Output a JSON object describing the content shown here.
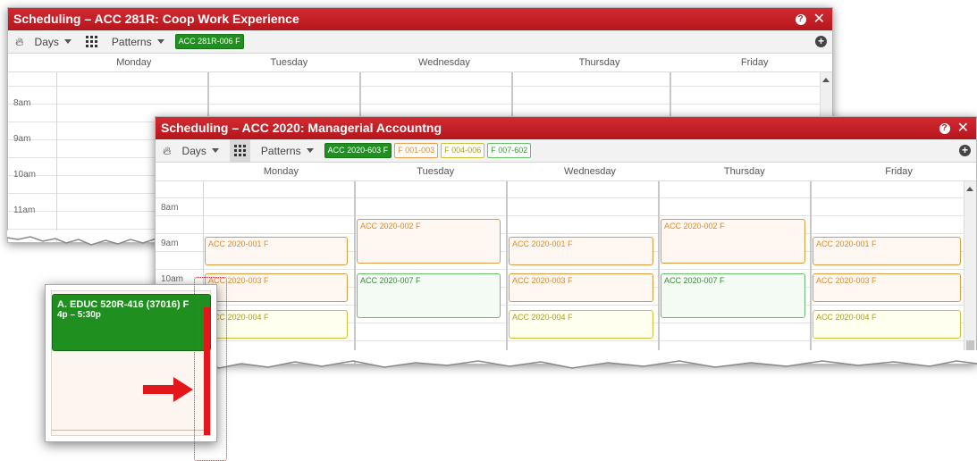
{
  "window_back": {
    "title": "Scheduling – ACC 281R: Coop Work Experience",
    "toolbar": {
      "days_label": "Days",
      "patterns_label": "Patterns",
      "chips": [
        "ACC 281R-006 F"
      ]
    },
    "days": [
      "Monday",
      "Tuesday",
      "Wednesday",
      "Thursday",
      "Friday"
    ],
    "times": [
      "8am",
      "9am",
      "10am",
      "11am"
    ]
  },
  "window_front": {
    "title": "Scheduling – ACC 2020: Managerial Accountng",
    "toolbar": {
      "days_label": "Days",
      "patterns_label": "Patterns",
      "chips": [
        "ACC 2020-603 F",
        "F 001-003",
        "F 004-006",
        "F 007-602"
      ]
    },
    "days": [
      "Monday",
      "Tuesday",
      "Wednesday",
      "Thursday",
      "Friday"
    ],
    "times": [
      "8am",
      "9am",
      "10am"
    ],
    "events": {
      "mon_1": "ACC 2020-001 F",
      "mon_2": "ACC 2020-003 F",
      "mon_3": "ACC 2020-004 F",
      "tue_1": "ACC 2020-002 F",
      "tue_2": "ACC 2020-007 F",
      "wed_1": "ACC 2020-001 F",
      "wed_2": "ACC 2020-003 F",
      "wed_3": "ACC 2020-004 F",
      "thu_1": "ACC 2020-002 F",
      "thu_2": "ACC 2020-007 F",
      "fri_1": "ACC 2020-001 F",
      "fri_2": "ACC 2020-003 F",
      "fri_3": "ACC 2020-004 F"
    }
  },
  "zoom_callout": {
    "event_title": "A. EDUC 520R-416 (37016) F",
    "event_time": "4p – 5:30p"
  },
  "colors": {
    "title_red": "#c11f25",
    "accent_green": "#1f8f1f",
    "event_orange": "#e08a2a",
    "event_green": "#6cbd6c",
    "event_yellow": "#c9c23a",
    "highlight_red": "#e3161c"
  }
}
